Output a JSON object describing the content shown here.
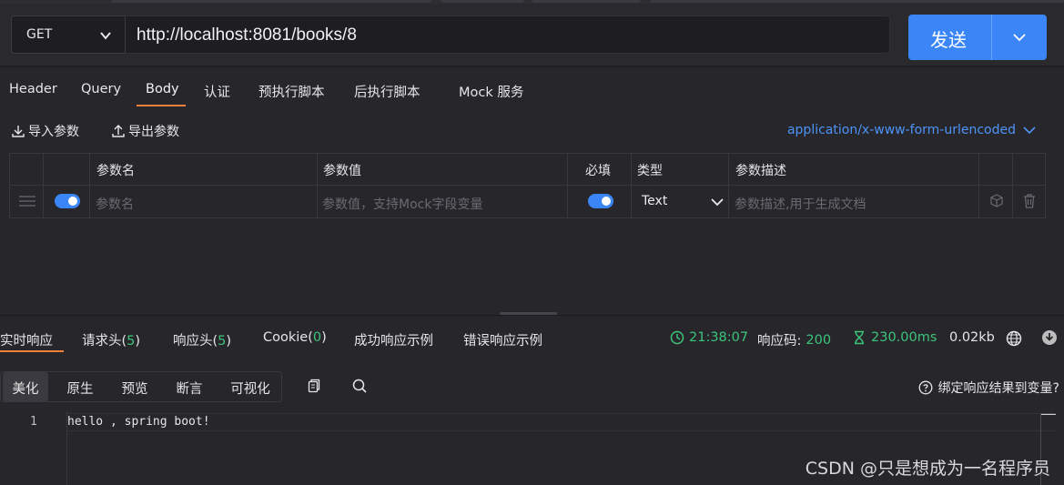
{
  "request": {
    "method": "GET",
    "url": "http://localhost:8081/books/8",
    "send_label": "发送"
  },
  "request_tabs": [
    "Header",
    "Query",
    "Body",
    "认证",
    "预执行脚本",
    "后执行脚本",
    "Mock 服务"
  ],
  "active_request_tab": "Body",
  "body_tools": {
    "import_label": "导入参数",
    "export_label": "导出参数",
    "content_type": "application/x-www-form-urlencoded"
  },
  "params_table": {
    "headers": {
      "name": "参数名",
      "value": "参数值",
      "required": "必填",
      "type": "类型",
      "description": "参数描述"
    },
    "row": {
      "enabled": true,
      "name_placeholder": "参数名",
      "value_placeholder": "参数值，支持Mock字段变量",
      "required": true,
      "type": "Text",
      "description_placeholder": "参数描述,用于生成文档"
    }
  },
  "response_tabs": {
    "realtime": "实时响应",
    "req_headers": "请求头(",
    "req_headers_count": "5",
    "resp_headers": "响应头(",
    "resp_headers_count": "5",
    "cookie": "Cookie(",
    "cookie_count": "0",
    "close_paren": ")",
    "success_example": "成功响应示例",
    "error_example": "错误响应示例"
  },
  "response_meta": {
    "time": "21:38:07",
    "status_label": "响应码:",
    "status_code": "200",
    "duration": "230.00ms",
    "size": "0.02kb"
  },
  "view_modes": [
    "美化",
    "原生",
    "预览",
    "断言",
    "可视化"
  ],
  "active_view_mode": "美化",
  "bind_response_label": "绑定响应结果到变量?",
  "response_body": {
    "line_number": "1",
    "text": "hello , spring boot!"
  },
  "watermark": "CSDN @只是想成为一名程序员",
  "colors": {
    "accent_blue": "#3b86f7",
    "accent_orange": "#f07f3c",
    "success_green": "#3cc47b",
    "background": "#27272b"
  }
}
